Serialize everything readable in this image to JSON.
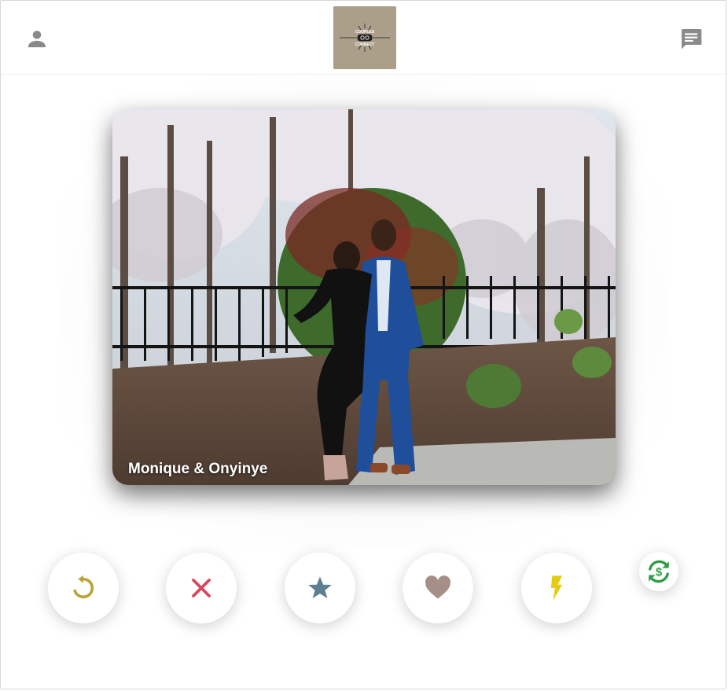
{
  "app": {
    "logo_text_top": "COUPLES",
    "logo_text_bottom": "CONNECT"
  },
  "header": {
    "profile_icon": "person-icon",
    "chat_icon": "chat-icon"
  },
  "card": {
    "name": "Monique & Onyinye"
  },
  "actions": [
    {
      "icon": "rewind-icon",
      "color": "#b9a43a"
    },
    {
      "icon": "close-icon",
      "color": "#d9485c"
    },
    {
      "icon": "star-icon",
      "color": "#5c7f92"
    },
    {
      "icon": "heart-icon",
      "color": "#a58f86"
    },
    {
      "icon": "bolt-icon",
      "color": "#e3cc12"
    },
    {
      "icon": "swap-icon",
      "color": "#2e9c45"
    }
  ],
  "colors": {
    "logo_bg": "#ab9f8a",
    "icon_gray": "#888888"
  }
}
